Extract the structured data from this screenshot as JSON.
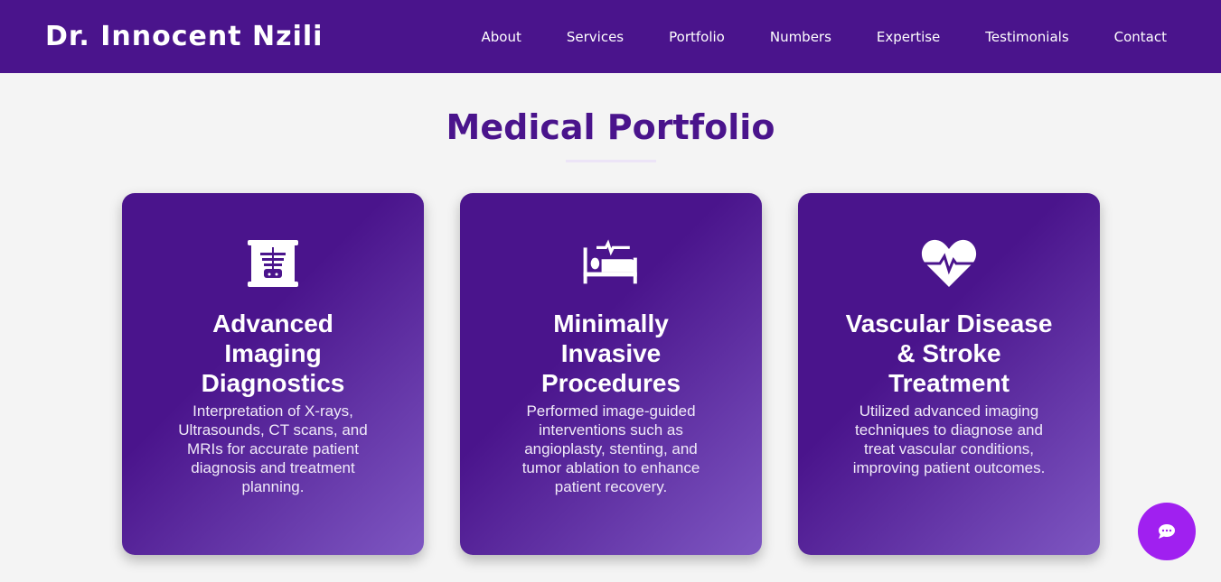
{
  "header": {
    "logo": "Dr. Innocent Nzili",
    "nav": [
      "About",
      "Services",
      "Portfolio",
      "Numbers",
      "Expertise",
      "Testimonials",
      "Contact"
    ]
  },
  "section": {
    "title": "Medical Portfolio"
  },
  "cards": [
    {
      "icon": "x-ray-icon",
      "title": "Advanced Imaging Diagnostics",
      "description": "Interpretation of X-rays, Ultrasounds, CT scans, and MRIs for accurate patient diagnosis and treatment planning."
    },
    {
      "icon": "procedures-bed-icon",
      "title": "Minimally Invasive Procedures",
      "description": "Performed image-guided interventions such as angioplasty, stenting, and tumor ablation to enhance patient recovery."
    },
    {
      "icon": "heartbeat-icon",
      "title": "Vascular Disease & Stroke Treatment",
      "description": "Utilized advanced imaging techniques to diagnose and treat vascular conditions, improving patient outcomes."
    }
  ],
  "chat": {
    "icon": "chat-icon"
  },
  "colors": {
    "primary": "#4a148c",
    "accent": "#7e57c2",
    "chat": "#a020f0"
  }
}
